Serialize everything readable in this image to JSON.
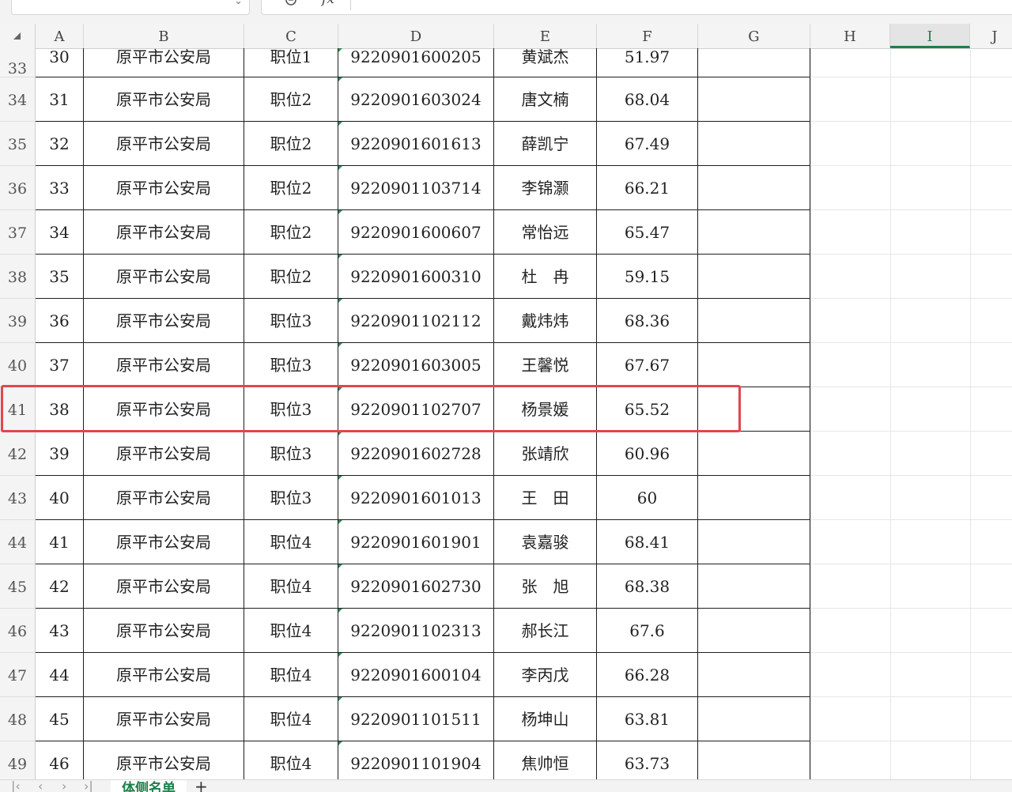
{
  "formula_bar": {
    "fx_label": "fx",
    "namebox_value": ""
  },
  "column_headers": [
    "A",
    "B",
    "C",
    "D",
    "E",
    "F",
    "G",
    "H",
    "I",
    "J"
  ],
  "selected_column": "I",
  "row_numbers": [
    "33",
    "34",
    "35",
    "36",
    "37",
    "38",
    "39",
    "40",
    "41",
    "42",
    "43",
    "44",
    "45",
    "46",
    "47",
    "48",
    "49"
  ],
  "rows": [
    {
      "seq": "30",
      "unit": "原平市公安局",
      "position": "职位1",
      "exam_id": "9220901600205",
      "name": "黄斌杰",
      "score": "51.97"
    },
    {
      "seq": "31",
      "unit": "原平市公安局",
      "position": "职位2",
      "exam_id": "9220901603024",
      "name": "唐文楠",
      "score": "68.04"
    },
    {
      "seq": "32",
      "unit": "原平市公安局",
      "position": "职位2",
      "exam_id": "9220901601613",
      "name": "薛凯宁",
      "score": "67.49"
    },
    {
      "seq": "33",
      "unit": "原平市公安局",
      "position": "职位2",
      "exam_id": "9220901103714",
      "name": "李锦灏",
      "score": "66.21"
    },
    {
      "seq": "34",
      "unit": "原平市公安局",
      "position": "职位2",
      "exam_id": "9220901600607",
      "name": "常怡远",
      "score": "65.47"
    },
    {
      "seq": "35",
      "unit": "原平市公安局",
      "position": "职位2",
      "exam_id": "9220901600310",
      "name": "杜　冉",
      "score": "59.15"
    },
    {
      "seq": "36",
      "unit": "原平市公安局",
      "position": "职位3",
      "exam_id": "9220901102112",
      "name": "戴炜炜",
      "score": "68.36"
    },
    {
      "seq": "37",
      "unit": "原平市公安局",
      "position": "职位3",
      "exam_id": "9220901603005",
      "name": "王馨悦",
      "score": "67.67"
    },
    {
      "seq": "38",
      "unit": "原平市公安局",
      "position": "职位3",
      "exam_id": "9220901102707",
      "name": "杨景媛",
      "score": "65.52"
    },
    {
      "seq": "39",
      "unit": "原平市公安局",
      "position": "职位3",
      "exam_id": "9220901602728",
      "name": "张靖欣",
      "score": "60.96"
    },
    {
      "seq": "40",
      "unit": "原平市公安局",
      "position": "职位3",
      "exam_id": "9220901601013",
      "name": "王　田",
      "score": "60"
    },
    {
      "seq": "41",
      "unit": "原平市公安局",
      "position": "职位4",
      "exam_id": "9220901601901",
      "name": "袁嘉骏",
      "score": "68.41"
    },
    {
      "seq": "42",
      "unit": "原平市公安局",
      "position": "职位4",
      "exam_id": "9220901602730",
      "name": "张　旭",
      "score": "68.38"
    },
    {
      "seq": "43",
      "unit": "原平市公安局",
      "position": "职位4",
      "exam_id": "9220901102313",
      "name": "郝长江",
      "score": "67.6"
    },
    {
      "seq": "44",
      "unit": "原平市公安局",
      "position": "职位4",
      "exam_id": "9220901600104",
      "name": "李丙戊",
      "score": "66.28"
    },
    {
      "seq": "45",
      "unit": "原平市公安局",
      "position": "职位4",
      "exam_id": "9220901101511",
      "name": "杨坤山",
      "score": "63.81"
    },
    {
      "seq": "46",
      "unit": "原平市公安局",
      "position": "职位4",
      "exam_id": "9220901101904",
      "name": "焦帅恒",
      "score": "63.73"
    }
  ],
  "highlighted_row": "41",
  "sheet_tabs": {
    "active": "体侧名单",
    "add_label": "+"
  },
  "colors": {
    "accent": "#1e7e4a",
    "highlight_border": "#e0474c",
    "cell_border": "#1e1e1e"
  }
}
